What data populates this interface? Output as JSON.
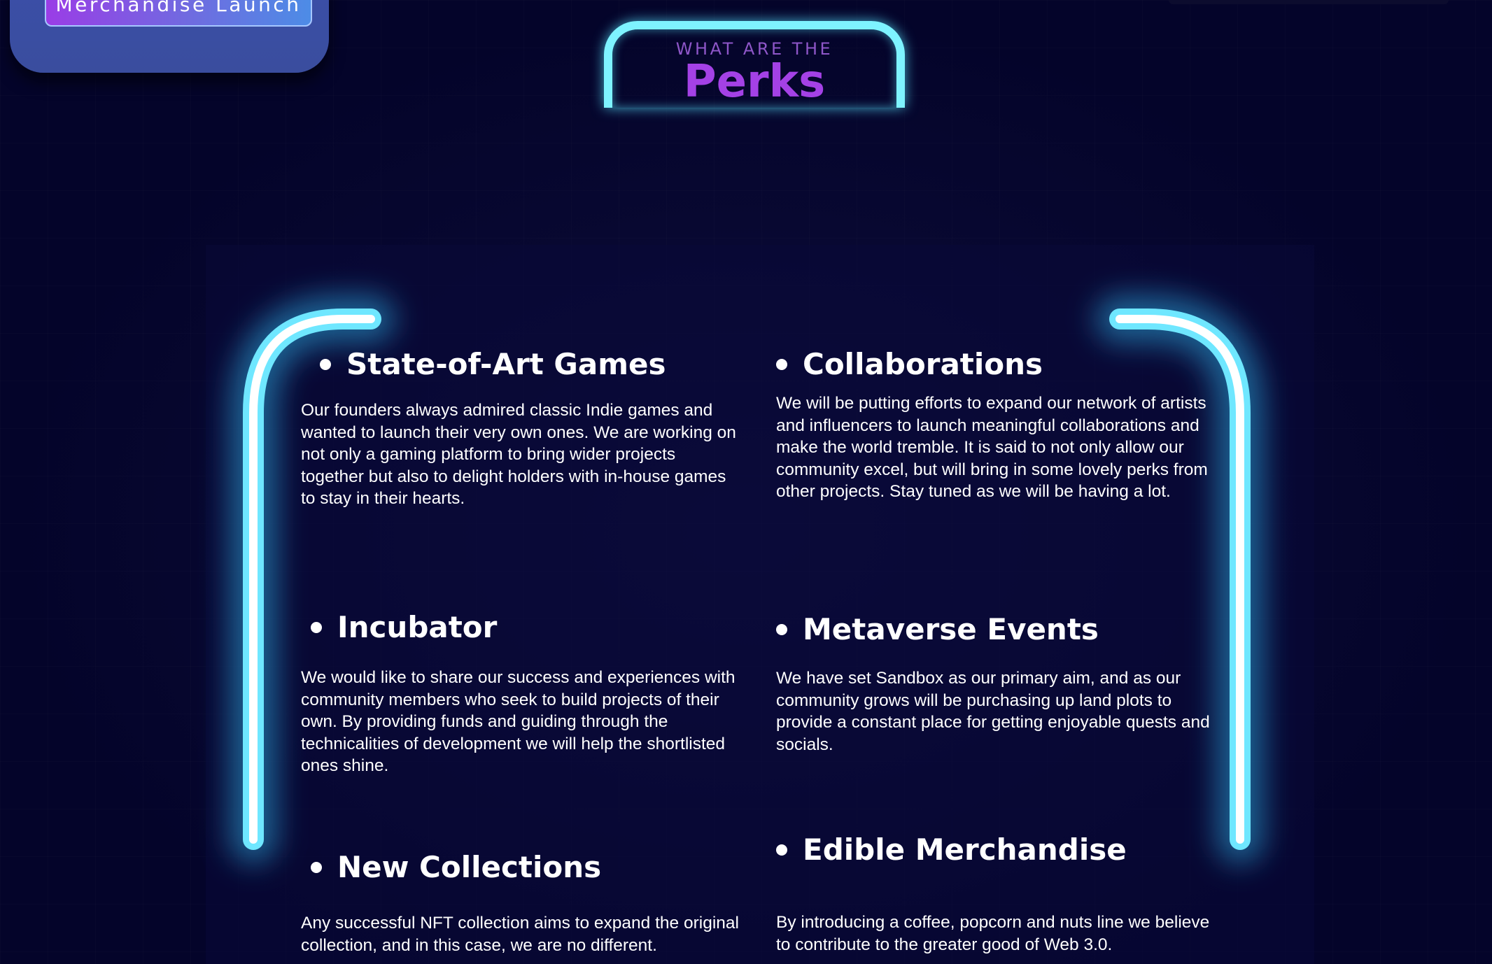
{
  "nav": {
    "launch_button_label": "Merchandise Launch"
  },
  "section": {
    "overline": "WHAT ARE THE",
    "title": "Perks"
  },
  "perks": [
    {
      "title": "State-of-Art Games",
      "body": "Our founders always admired classic Indie games and wanted to launch their very own ones. We are working on not only a gaming platform to bring wider projects together but also to delight holders with in-house games to stay in their hearts."
    },
    {
      "title": "Collaborations",
      "body": "We will be putting efforts to expand our network of artists and influencers to launch meaningful collaborations and make the world tremble. It is said to not only allow our community excel, but will bring in some lovely perks from other projects. Stay tuned as we will be having a lot."
    },
    {
      "title": "Incubator",
      "body": " We would like to share our success and experiences with community members who seek to build projects of their own. By providing funds and guiding through the technicalities of development we will help the shortlisted ones shine."
    },
    {
      "title": "Metaverse Events",
      "body": "We have set Sandbox as our primary aim, and as our community grows will be purchasing up land plots to provide a constant place for getting enjoyable quests and socials."
    },
    {
      "title": "New Collections",
      "body": "Any successful NFT collection aims to expand the original collection, and in this case, we are no different."
    },
    {
      "title": "Edible Merchandise",
      "body": "By introducing a coffee, popcorn and nuts line we believe to contribute to the greater good of Web 3.0."
    }
  ],
  "colors": {
    "background": "#04042a",
    "neon_cyan": "#7ef3ff",
    "accent_purple": "#a441e6",
    "launch_panel": "#3b4fa8"
  }
}
